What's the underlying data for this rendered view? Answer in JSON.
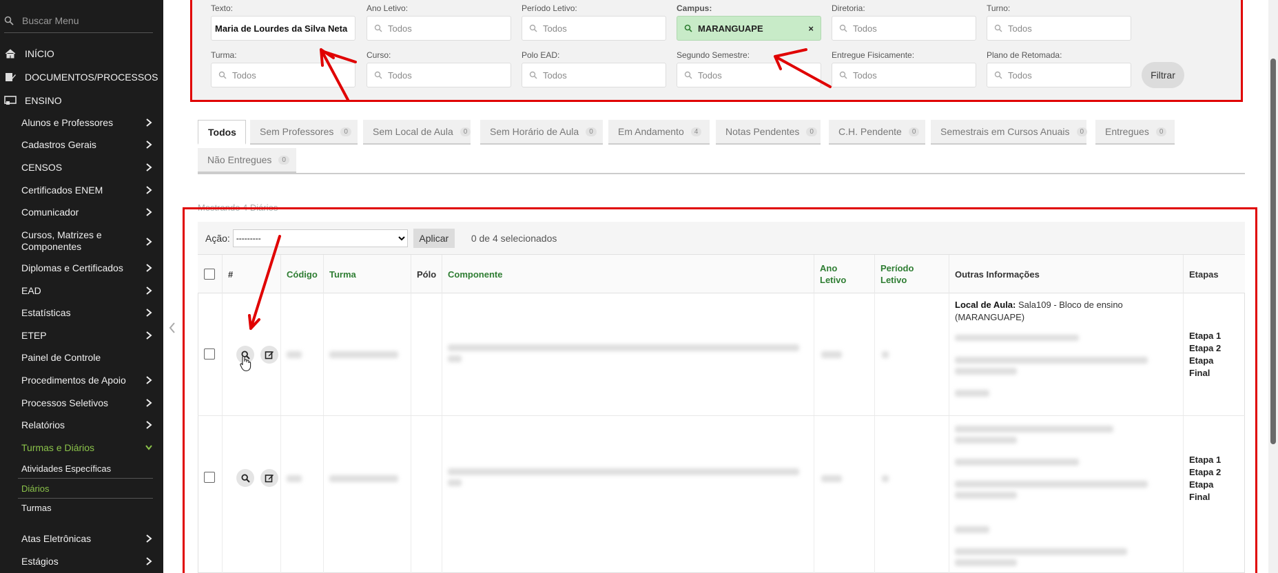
{
  "sidebar": {
    "search_placeholder": "Buscar Menu",
    "top_items": [
      {
        "label": "INÍCIO",
        "icon": "home-icon"
      },
      {
        "label": "DOCUMENTOS/PROCESSOS",
        "icon": "document-icon"
      },
      {
        "label": "ENSINO",
        "icon": "ensino-icon"
      }
    ],
    "sub_items": [
      {
        "label": "Alunos e Professores"
      },
      {
        "label": "Cadastros Gerais"
      },
      {
        "label": "CENSOS"
      },
      {
        "label": "Certificados ENEM"
      },
      {
        "label": "Comunicador"
      },
      {
        "label": "Cursos, Matrizes e Componentes"
      },
      {
        "label": "Diplomas e Certificados"
      },
      {
        "label": "EAD"
      },
      {
        "label": "Estatísticas"
      },
      {
        "label": "ETEP"
      },
      {
        "label": "Painel de Controle"
      },
      {
        "label": "Procedimentos de Apoio"
      },
      {
        "label": "Processos Seletivos"
      },
      {
        "label": "Relatórios"
      },
      {
        "label": "Turmas e Diários"
      },
      {
        "label": "Atividades Específicas"
      },
      {
        "label": "Diários"
      },
      {
        "label": "Turmas"
      },
      {
        "label": "Atas Eletrônicas"
      },
      {
        "label": "Estágios"
      }
    ]
  },
  "filters": {
    "row1": [
      {
        "label": "Texto:",
        "value": "Maria de Lourdes da Silva Neta"
      },
      {
        "label": "Ano Letivo:",
        "placeholder": "Todos"
      },
      {
        "label": "Período Letivo:",
        "placeholder": "Todos"
      },
      {
        "label": "Campus:",
        "value": "MARANGUAPE",
        "remove": "×"
      },
      {
        "label": "Diretoria:",
        "placeholder": "Todos"
      },
      {
        "label": "Turno:",
        "placeholder": "Todos"
      }
    ],
    "row2": [
      {
        "label": "Turma:",
        "placeholder": "Todos"
      },
      {
        "label": "Curso:",
        "placeholder": "Todos"
      },
      {
        "label": "Polo EAD:",
        "placeholder": "Todos"
      },
      {
        "label": "Segundo Semestre:",
        "placeholder": "Todos"
      },
      {
        "label": "Entregue Fisicamente:",
        "placeholder": "Todos"
      },
      {
        "label": "Plano de Retomada:",
        "placeholder": "Todos"
      }
    ],
    "filter_button": "Filtrar"
  },
  "tabs": [
    {
      "label": "Todos",
      "count": ""
    },
    {
      "label": "Sem Professores",
      "count": "0"
    },
    {
      "label": "Sem Local de Aula",
      "count": "0"
    },
    {
      "label": "Sem Horário de Aula",
      "count": "0"
    },
    {
      "label": "Em Andamento",
      "count": "4"
    },
    {
      "label": "Notas Pendentes",
      "count": "0"
    },
    {
      "label": "C.H. Pendente",
      "count": "0"
    },
    {
      "label": "Semestrais em Cursos Anuais",
      "count": "0"
    },
    {
      "label": "Entregues",
      "count": "0"
    },
    {
      "label": "Não Entregues",
      "count": "0"
    }
  ],
  "listing": {
    "showing": "Mostrando 4 Diários",
    "action_label": "Ação:",
    "action_option": "---------",
    "apply_button": "Aplicar",
    "selected": "0 de 4 selecionados"
  },
  "table": {
    "headers": [
      "#",
      "Código",
      "Turma",
      "Pólo",
      "Componente",
      "Ano Letivo",
      "Período Letivo",
      "Outras Informações",
      "Etapas"
    ],
    "rows": [
      {
        "local_label": "Local de Aula:",
        "local_value": "Sala109 - Bloco de ensino (MARANGUAPE)",
        "etapas": [
          "Etapa 1",
          "Etapa 2",
          "Etapa",
          "Final"
        ]
      },
      {
        "etapas": [
          "Etapa 1",
          "Etapa 2",
          "Etapa",
          "Final"
        ]
      }
    ]
  },
  "colors": {
    "sidebar_bg": "#1c1c1c",
    "accent_green": "#2e7d32",
    "active_green": "#8bc34a",
    "annotation_red": "#e00000"
  }
}
